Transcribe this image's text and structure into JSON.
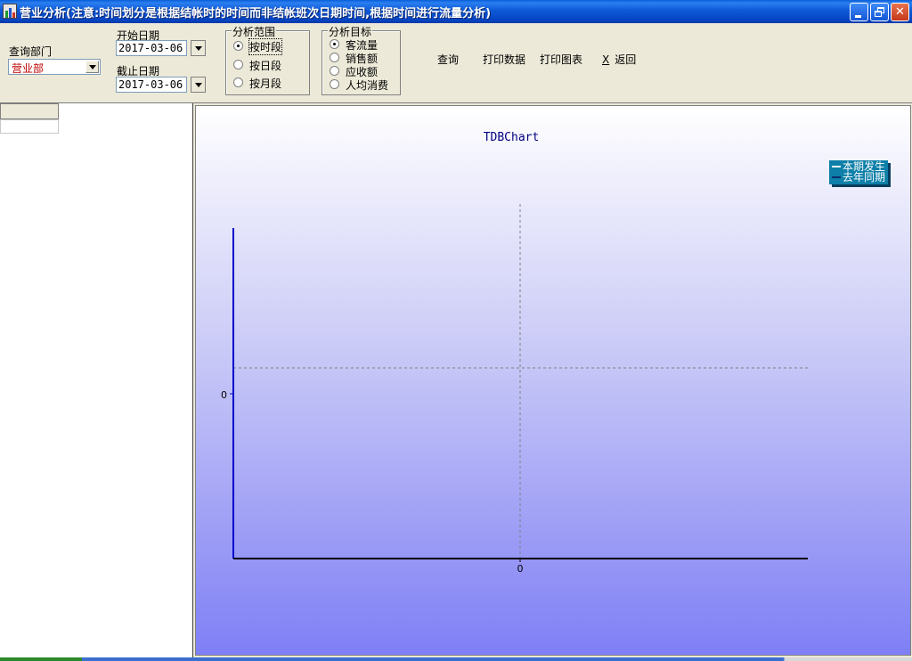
{
  "window": {
    "title": "营业分析(注意:时间划分是根据结帐时的时间而非结帐班次日期时间,根据时间进行流量分析)"
  },
  "query": {
    "dept_label": "查询部门",
    "dept_value": "营业部",
    "start_label": "开始日期",
    "start_value": "2017-03-06",
    "end_label": "截止日期",
    "end_value": "2017-03-06"
  },
  "range_group": {
    "title": "分析范围",
    "options": [
      {
        "label": "按时段",
        "selected": true
      },
      {
        "label": "按日段",
        "selected": false
      },
      {
        "label": "按月段",
        "selected": false
      }
    ]
  },
  "target_group": {
    "title": "分析目标",
    "options": [
      {
        "label": "客流量",
        "selected": true
      },
      {
        "label": "销售额",
        "selected": false
      },
      {
        "label": "应收额",
        "selected": false
      },
      {
        "label": "人均消费",
        "selected": false
      }
    ]
  },
  "actions": {
    "query": "查询",
    "print_data": "打印数据",
    "print_chart": "打印图表",
    "back_accel": "X",
    "back": "返回"
  },
  "chart_data": {
    "type": "line",
    "title": "TDBChart",
    "xlabel": "",
    "ylabel": "",
    "x_tick_labels": [
      "0"
    ],
    "y_tick_labels": [
      "0"
    ],
    "grid": true,
    "legend_position": "top-right",
    "series": [
      {
        "name": "本期发生",
        "values": [],
        "color": "#ffffff"
      },
      {
        "name": "去年同期",
        "values": [],
        "color": "#0a2f6e"
      }
    ],
    "colors": {
      "y_axis": "#0000cc",
      "x_axis": "#000000",
      "grid": "#808080"
    }
  }
}
